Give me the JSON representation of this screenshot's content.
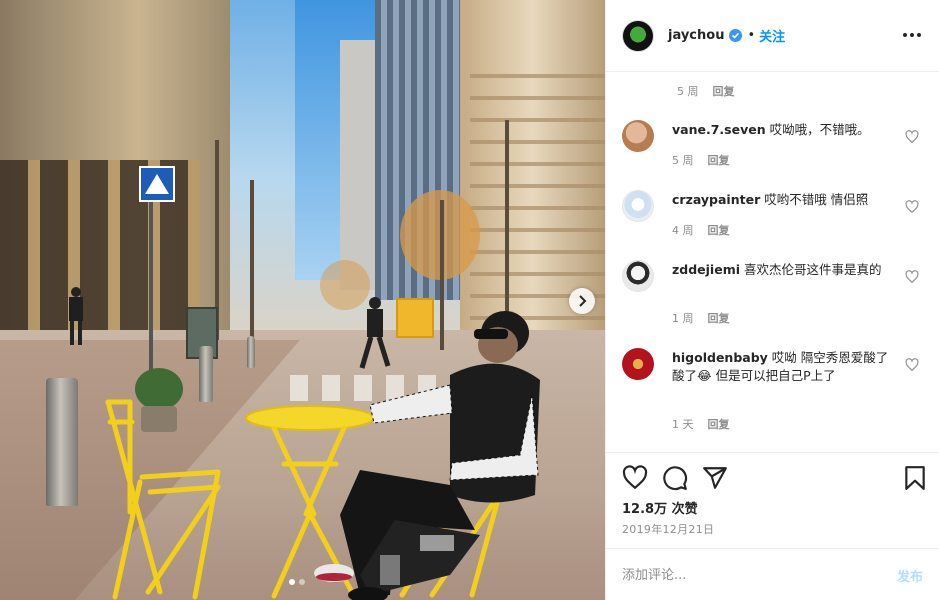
{
  "post": {
    "username": "jaychou",
    "follow_label": "关注",
    "separator": "•"
  },
  "top_meta": {
    "time": "5 周",
    "reply": "回复"
  },
  "comments": [
    {
      "user": "vane.7.seven",
      "text": "哎呦哦，不错哦。",
      "time": "5 周",
      "reply": "回复"
    },
    {
      "user": "crzaypainter",
      "text": "哎哟不错哦 情侣照",
      "time": "4 周",
      "reply": "回复"
    },
    {
      "user": "zddejiemi",
      "text": "喜欢杰伦哥这件事是真的",
      "time": "1 周",
      "reply": "回复"
    },
    {
      "user": "higoldenbaby",
      "text": "哎呦 隔空秀恩爱酸了酸了😂 但是可以把自己P上了",
      "time": "1 天",
      "reply": "回复"
    }
  ],
  "likes": {
    "count": "12.8万",
    "label": "次赞"
  },
  "date": "2019年12月21日",
  "composer": {
    "placeholder": "添加评论...",
    "post_label": "发布"
  },
  "colors": {
    "accent": "#0095f6",
    "verified": "#3897f0",
    "post_disabled": "#b2dffc",
    "muted": "#8e8e8e"
  },
  "icons": [
    "verified-badge-icon",
    "more-options-icon",
    "heart-icon",
    "comment-icon",
    "share-icon",
    "bookmark-icon",
    "chevron-right-icon"
  ],
  "carousel": {
    "slides": 2,
    "current": 1
  }
}
